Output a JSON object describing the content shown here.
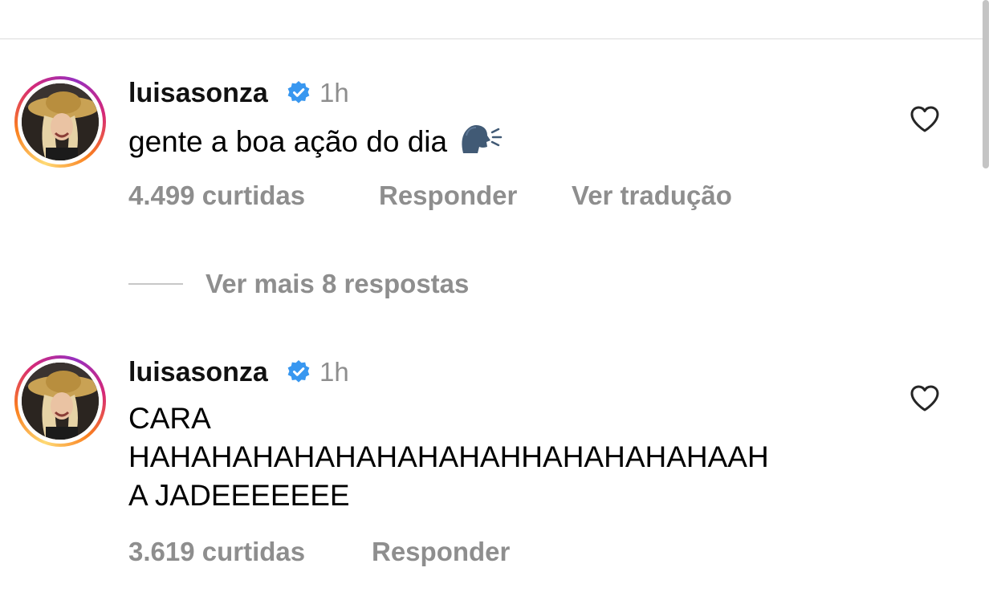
{
  "comments": [
    {
      "username": "luisasonza",
      "time": "1h",
      "text_lines": [
        "gente a boa ação do dia"
      ],
      "emoji": "speaking-head-icon",
      "likes": "4.499 curtidas",
      "reply_label": "Responder",
      "translate_label": "Ver tradução"
    },
    {
      "username": "luisasonza",
      "time": "1h",
      "text_lines": [
        "CARA",
        "HAHAHAHAHAHAHAHAHAHHAHAHAHAHAAH",
        "A JADEEEEEEE"
      ],
      "likes": "3.619 curtidas",
      "reply_label": "Responder"
    }
  ],
  "view_more_replies": "Ver mais 8 respostas",
  "colors": {
    "secondary_text": "#8e8e8e",
    "verified_blue": "#3897f0",
    "divider": "#dbdbdb"
  }
}
